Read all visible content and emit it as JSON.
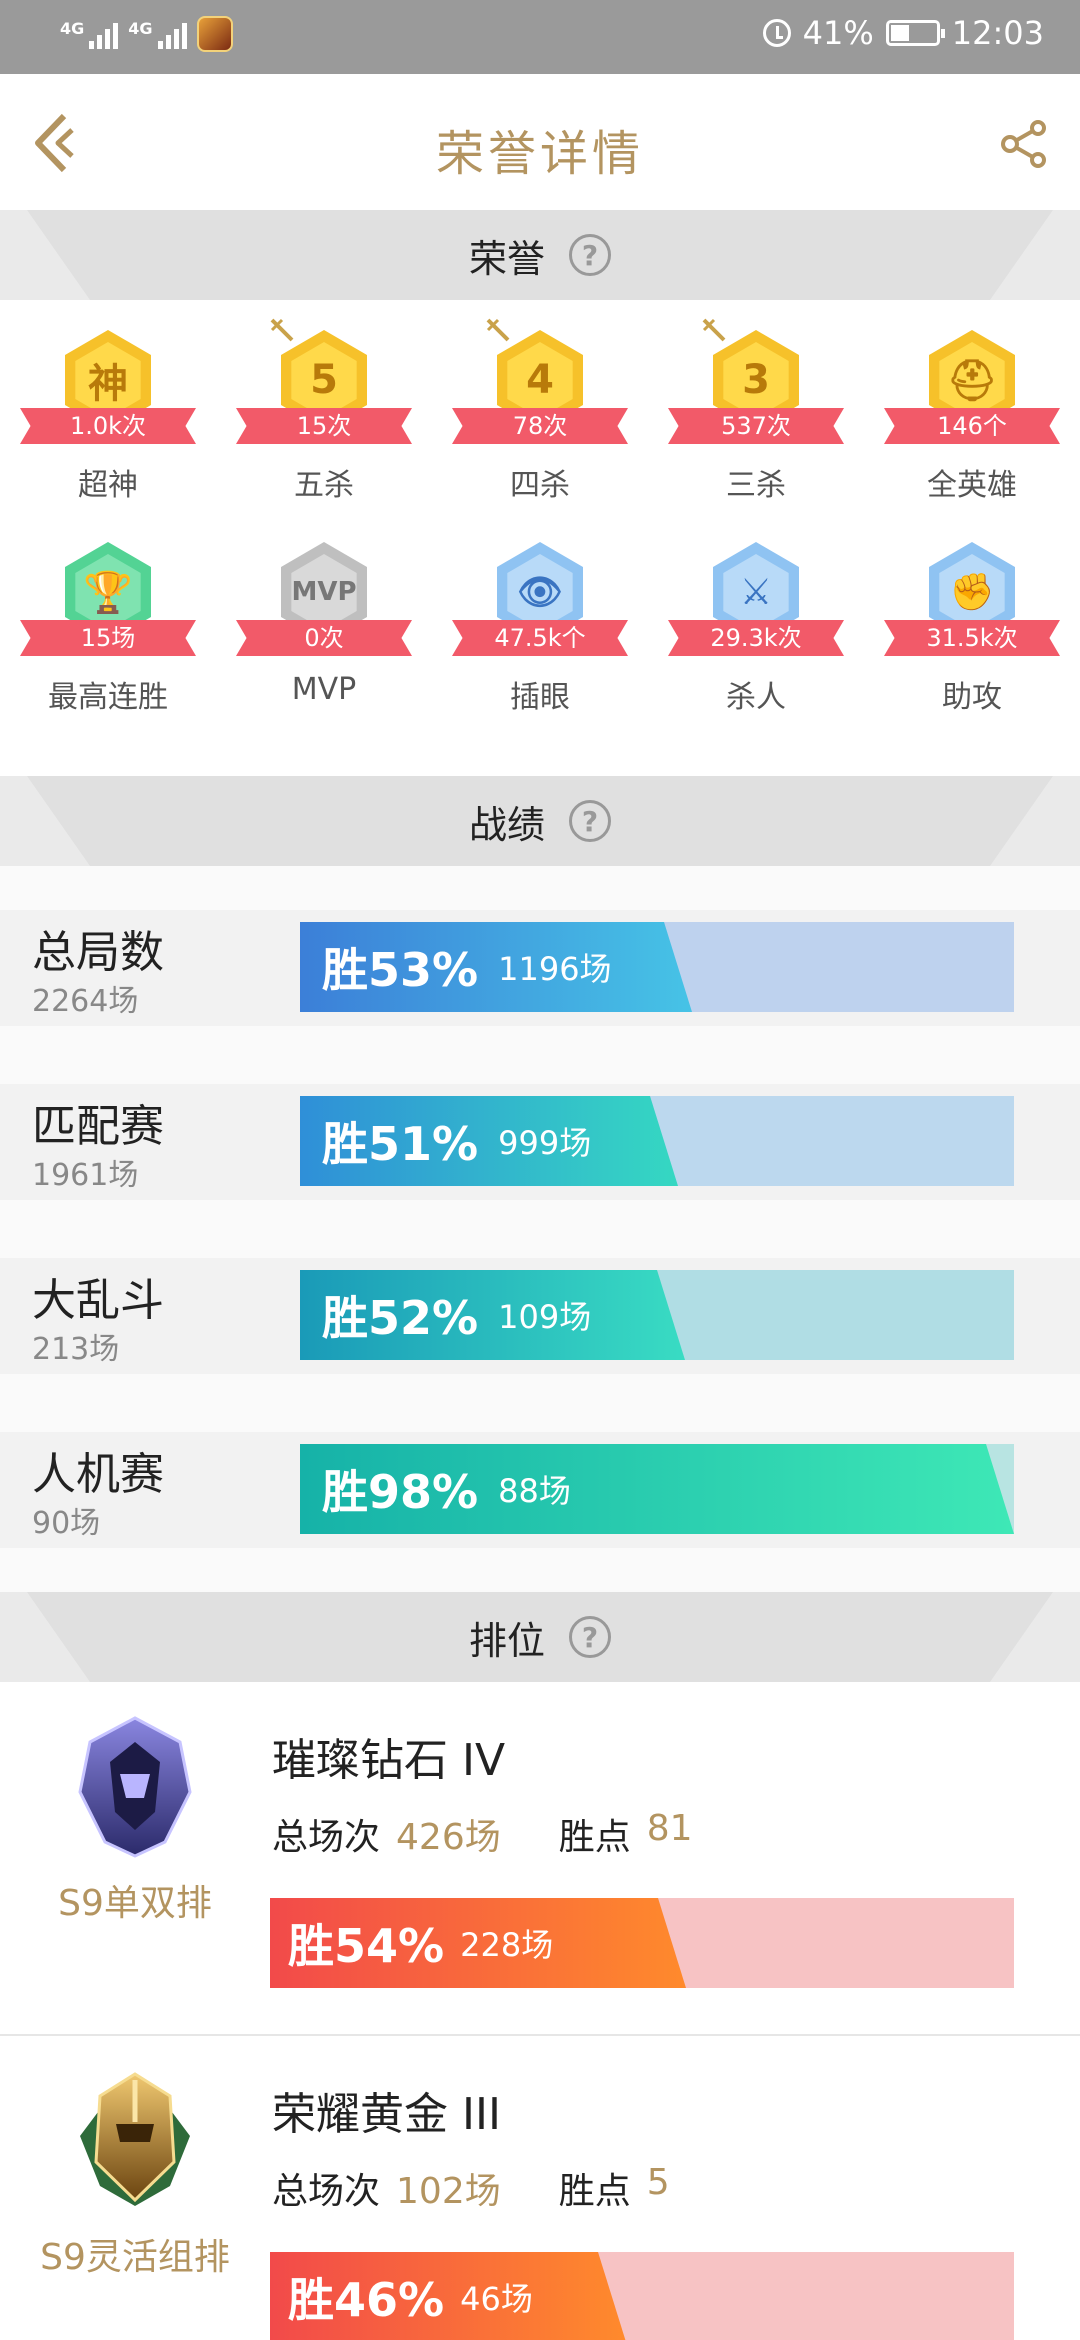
{
  "status_bar": {
    "net1": "4G",
    "net2": "4G",
    "battery": "41%",
    "time": "12:03"
  },
  "header": {
    "title": "荣誉详情"
  },
  "honor_section": {
    "title": "荣誉",
    "help": "?"
  },
  "honors": [
    {
      "label": "超神",
      "value": "1.0k次",
      "glyph": "神",
      "style": "gold",
      "icon": "god-like-badge-icon"
    },
    {
      "label": "五杀",
      "value": "15次",
      "glyph": "5",
      "style": "gold",
      "icon": "penta-kill-badge-icon"
    },
    {
      "label": "四杀",
      "value": "78次",
      "glyph": "4",
      "style": "gold",
      "icon": "quadra-kill-badge-icon"
    },
    {
      "label": "三杀",
      "value": "537次",
      "glyph": "3",
      "style": "gold",
      "icon": "triple-kill-badge-icon"
    },
    {
      "label": "全英雄",
      "value": "146个",
      "glyph": "⛑",
      "style": "gold",
      "icon": "all-heroes-badge-icon"
    },
    {
      "label": "最高连胜",
      "value": "15场",
      "glyph": "🏆",
      "style": "green",
      "icon": "win-streak-trophy-icon"
    },
    {
      "label": "MVP",
      "value": "0次",
      "glyph": "MVP",
      "style": "gray",
      "icon": "mvp-badge-icon"
    },
    {
      "label": "插眼",
      "value": "47.5k个",
      "glyph": "👁",
      "style": "blue",
      "icon": "ward-badge-icon"
    },
    {
      "label": "杀人",
      "value": "29.3k次",
      "glyph": "⚔",
      "style": "blue",
      "icon": "kills-badge-icon"
    },
    {
      "label": "助攻",
      "value": "31.5k次",
      "glyph": "✊",
      "style": "blue",
      "icon": "assists-badge-icon"
    }
  ],
  "record_section": {
    "title": "战绩",
    "help": "?"
  },
  "records": [
    {
      "name": "总局数",
      "total": "2264场",
      "win_pct": "胜53%",
      "win_games": "1196场",
      "win_rate": 0.53,
      "fill": "linear-gradient(90deg,#3c7fd8,#46c3e6)",
      "track": "#bed2ee"
    },
    {
      "name": "匹配赛",
      "total": "1961场",
      "win_pct": "胜51%",
      "win_games": "999场",
      "win_rate": 0.51,
      "fill": "linear-gradient(90deg,#2f8fd8,#35d8c2)",
      "track": "#bcd8ee"
    },
    {
      "name": "大乱斗",
      "total": "213场",
      "win_pct": "胜52%",
      "win_games": "109场",
      "win_rate": 0.52,
      "fill": "linear-gradient(90deg,#1a9ab8,#39dcc3)",
      "track": "#b0dde4"
    },
    {
      "name": "人机赛",
      "total": "90场",
      "win_pct": "胜98%",
      "win_games": "88场",
      "win_rate": 0.98,
      "fill": "linear-gradient(90deg,#16b2a8,#3ee8b6)",
      "track": "#b8e4e2"
    }
  ],
  "rank_section": {
    "title": "排位",
    "help": "?"
  },
  "ranks": [
    {
      "mode": "S9单双排",
      "tier": "璀璨钻石 IV",
      "total_label": "总场次",
      "total": "426场",
      "points_label": "胜点",
      "points": "81",
      "win_pct": "胜54%",
      "win_games": "228场",
      "win_rate": 0.54,
      "emblem": "diamond-rank-emblem-icon"
    },
    {
      "mode": "S9灵活组排",
      "tier": "荣耀黄金 III",
      "total_label": "总场次",
      "total": "102场",
      "points_label": "胜点",
      "points": "5",
      "win_pct": "胜46%",
      "win_games": "46场",
      "win_rate": 0.46,
      "emblem": "gold-rank-emblem-icon"
    }
  ]
}
